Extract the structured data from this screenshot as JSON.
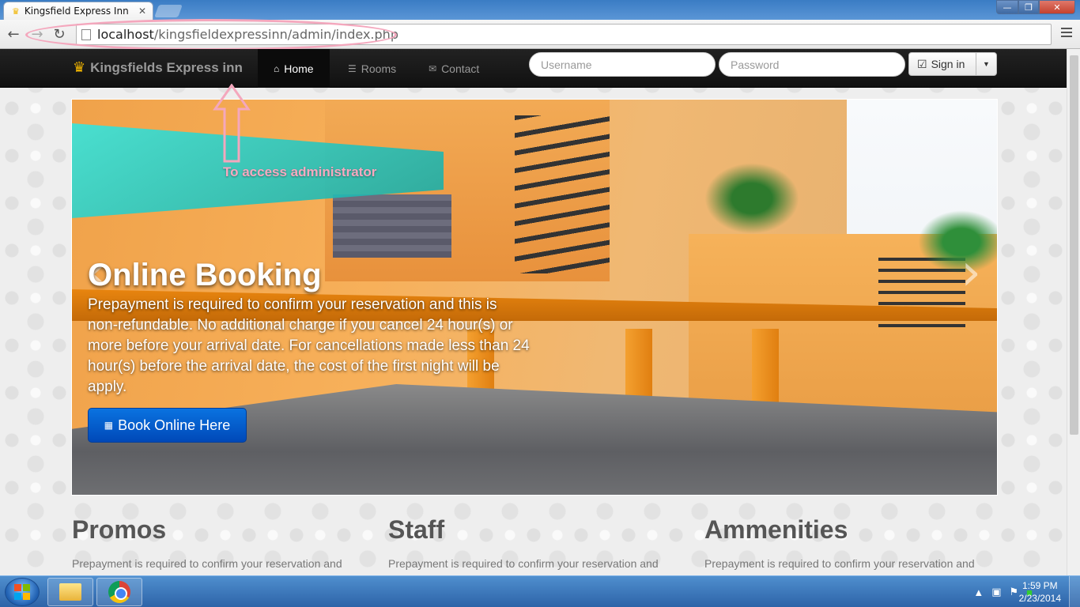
{
  "browser": {
    "tab_title": "Kingsfield Express Inn",
    "tab_close": "✕",
    "url_host": "localhost",
    "url_path": "/kingsfieldexpressinn/admin/index.php",
    "window_buttons": {
      "minimize": "—",
      "maximize": "❐",
      "close": "✕"
    }
  },
  "navbar": {
    "brand": "Kingsfields Express inn",
    "items": [
      {
        "label": "Home",
        "icon": "home-icon",
        "active": true
      },
      {
        "label": "Rooms",
        "icon": "list-icon",
        "active": false
      },
      {
        "label": "Contact",
        "icon": "envelope-icon",
        "active": false
      }
    ],
    "username_placeholder": "Username",
    "password_placeholder": "Password",
    "signin_label": "Sign in"
  },
  "hero": {
    "title": "Online Booking",
    "text": "Prepayment is required to confirm your reservation and this is non-refundable. No additional charge if you cancel 24 hour(s) or more before your arrival date. For cancellations made less than 24 hour(s) before the arrival date, the cost of the first night will be apply.",
    "button_label": "Book Online Here",
    "prev_arrow": "‹",
    "next_arrow": "›"
  },
  "annotation": {
    "text": "To access administrator",
    "color": "#f7a9c0"
  },
  "sections": [
    {
      "title": "Promos",
      "text": "Prepayment is required to confirm your reservation and"
    },
    {
      "title": "Staff",
      "text": "Prepayment is required to confirm your reservation and"
    },
    {
      "title": "Ammenities",
      "text": "Prepayment is required to confirm your reservation and"
    }
  ],
  "taskbar": {
    "time": "1:59 PM",
    "date": "2/23/2014",
    "tray_arrow": "▲"
  },
  "colors": {
    "navbar_bg": "#111111",
    "book_button": "#0a63d0",
    "accent_crown": "#f5b800"
  }
}
